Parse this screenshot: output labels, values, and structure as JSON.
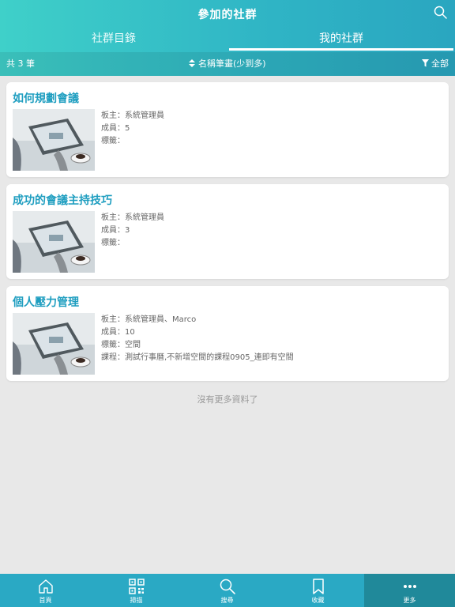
{
  "header": {
    "title": "參加的社群",
    "tabs": [
      {
        "label": "社群目錄"
      },
      {
        "label": "我的社群"
      }
    ],
    "count": "共 3 筆",
    "sort": "名稱筆畫(少到多)",
    "filter": "全部"
  },
  "groups": [
    {
      "title": "如何規劃會議",
      "owner": "板主：系統管理員",
      "members": "成員：5",
      "tags": "標籤："
    },
    {
      "title": "成功的會議主持技巧",
      "owner": "板主：系統管理員",
      "members": "成員：3",
      "tags": "標籤："
    },
    {
      "title": "個人壓力管理",
      "owner": "板主：系統管理員、Marco",
      "members": "成員：10",
      "tags": "標籤：空間",
      "courses": "課程：測試行事曆,不新增空間的課程0905_連即有空間"
    }
  ],
  "footer_message": "沒有更多資料了",
  "nav": [
    {
      "label": "首頁",
      "icon": "home-icon"
    },
    {
      "label": "掃描",
      "icon": "qr-code-icon"
    },
    {
      "label": "搜尋",
      "icon": "search-icon"
    },
    {
      "label": "收藏",
      "icon": "bookmark-icon"
    },
    {
      "label": "更多",
      "icon": "more-icon"
    }
  ],
  "colors": {
    "accent": "#2aa9c4",
    "title_text": "#1f9ec0",
    "nav_active": "#20899a"
  }
}
